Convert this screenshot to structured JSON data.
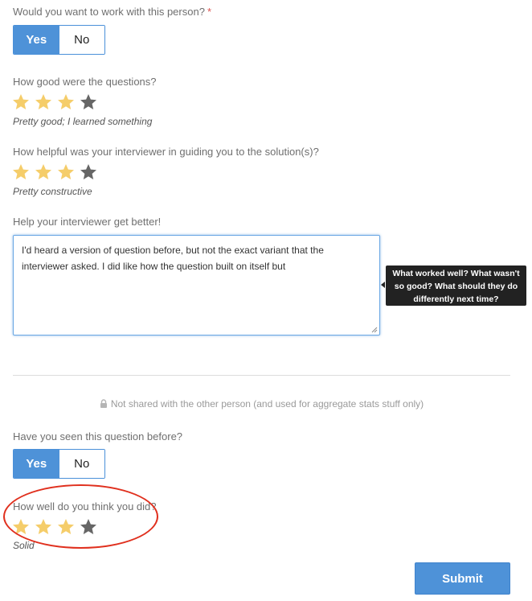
{
  "q1": {
    "label": "Would you want to work with this person?",
    "required_mark": "*",
    "options": [
      "Yes",
      "No"
    ],
    "selected": "Yes"
  },
  "q2": {
    "label": "How good were the questions?",
    "rating": 3,
    "max": 4,
    "caption": "Pretty good; I learned something"
  },
  "q3": {
    "label": "How helpful was your interviewer in guiding you to the solution(s)?",
    "rating": 3,
    "max": 4,
    "caption": "Pretty constructive"
  },
  "q4": {
    "label": "Help your interviewer get better!",
    "value": "I'd heard a version of question before, but not the exact variant that the interviewer asked. I did like how the question built on itself but",
    "tooltip": "What worked well? What wasn't so good? What should they do differently next time?"
  },
  "private_note": "Not shared with the other person (and used for aggregate stats stuff only)",
  "q5": {
    "label": "Have you seen this question before?",
    "options": [
      "Yes",
      "No"
    ],
    "selected": "Yes"
  },
  "q6": {
    "label": "How well do you think you did?",
    "rating": 3,
    "max": 4,
    "caption": "Solid"
  },
  "submit_label": "Submit",
  "colors": {
    "star_filled": "#f5cd6a",
    "star_empty": "#666666",
    "accent": "#4e92d8",
    "annotation": "#e0301e"
  },
  "icons": {
    "star": "star-icon",
    "lock": "lock-icon"
  }
}
